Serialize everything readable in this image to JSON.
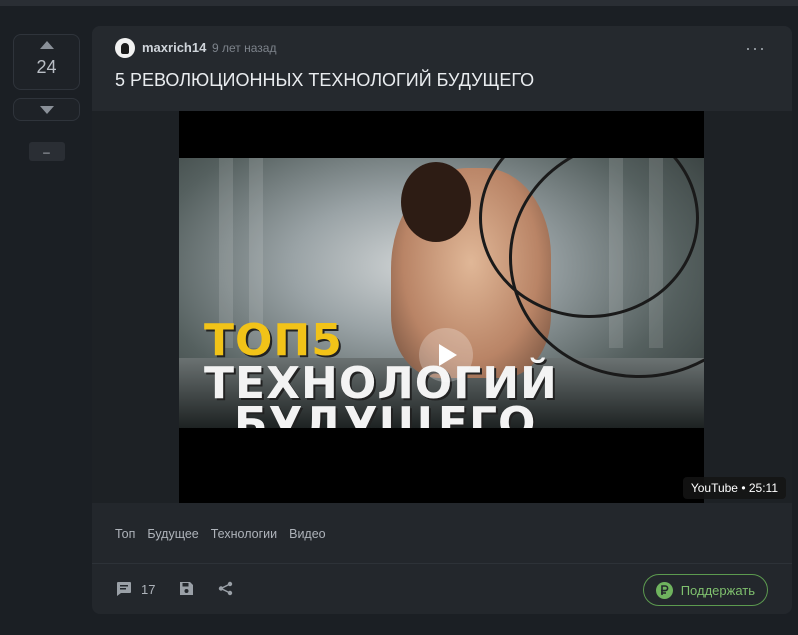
{
  "votes": {
    "count": "24",
    "minus_label": "–"
  },
  "post": {
    "author": "maxrich14",
    "time": "9 лет назад",
    "title": "5 РЕВОЛЮЦИОННЫХ ТЕХНОЛОГИЙ БУДУЩЕГО",
    "more_label": "···"
  },
  "video": {
    "thumb_line1": "ТОП5",
    "thumb_line2": "ТЕХНОЛОГИЙ",
    "thumb_line3": "БУДУЩЕГО",
    "badge": "YouTube • 25:11"
  },
  "tags": [
    "Топ",
    "Будущее",
    "Технологии",
    "Видео"
  ],
  "footer": {
    "comments_count": "17",
    "support_label": "Поддержать"
  },
  "colors": {
    "accent_green": "#7fc06e",
    "brand_yellow": "#f2c318"
  },
  "icons": [
    "arrow-up-icon",
    "arrow-down-icon",
    "comment-icon",
    "save-icon",
    "share-icon",
    "ruble-icon",
    "more-icon",
    "play-icon"
  ]
}
